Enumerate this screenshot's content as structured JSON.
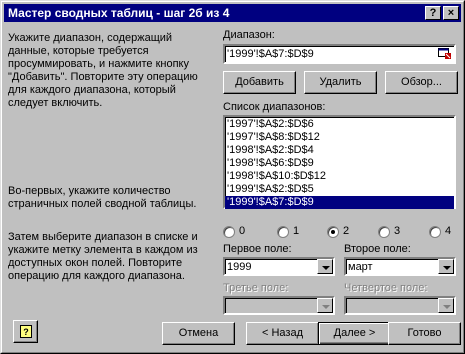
{
  "window": {
    "title": "Мастер сводных таблиц - шаг 2б из 4",
    "help_glyph": "?",
    "close_glyph": "×"
  },
  "instructions": {
    "para1": "Укажите диапазон, содержащий\nданные, которые требуется\nпросуммировать, и нажмите кнопку\n\"Добавить\". Повторите эту операцию\nдля каждого диапазона, который\nследует включить.",
    "para2": "Во-первых, укажите количество\nстраничных полей сводной таблицы.",
    "para3": "Затем выберите диапазон в списке и\nукажите метку элемента в каждом из\nдоступных окон полей. Повторите\nоперацию для каждого диапазона."
  },
  "range": {
    "label": "Диапазон:",
    "value": "'1999'!$A$7:$D$9"
  },
  "buttons": {
    "add": "Добавить",
    "delete": "Удалить",
    "browse": "Обзор...",
    "cancel": "Отмена",
    "back": "< Назад",
    "next": "Далее >",
    "finish": "Готово"
  },
  "range_list": {
    "label": "Список диапазонов:",
    "items": [
      "'1997'!$A$2:$D$6",
      "'1997'!$A$8:$D$12",
      "'1998'!$A$2:$D$4",
      "'1998'!$A$6:$D$9",
      "'1998'!$A$10:$D$12",
      "'1999'!$A$2:$D$5",
      "'1999'!$A$7:$D$9"
    ],
    "selected_index": 6
  },
  "page_fields": {
    "options": [
      "0",
      "1",
      "2",
      "3",
      "4"
    ],
    "selected": "2"
  },
  "fields": {
    "first_label": "Первое поле:",
    "first_value": "1999",
    "second_label": "Второе поле:",
    "second_value": "март",
    "third_label": "Третье поле:",
    "third_value": "",
    "fourth_label": "Четвертое поле:",
    "fourth_value": ""
  },
  "assistant_icon": "office-assistant-icon"
}
